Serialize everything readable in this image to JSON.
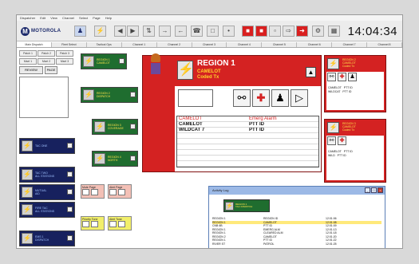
{
  "menubar": [
    "Dispatcher",
    "Edit",
    "View",
    "Channel",
    "Select",
    "Page",
    "Help"
  ],
  "toolbar": {
    "logo_text": "MOTOROLA",
    "clock": "14:04:34",
    "buttons": [
      "users-icon",
      "lightning-icon",
      "back-icon",
      "forward-icon",
      "split-icon",
      "arrow-icon",
      "arrow-icon",
      "monitor-icon",
      "phone-icon",
      "stop-icon",
      "stop-icon",
      "stop-icon",
      "chart-icon",
      "transfer-icon",
      "patch-icon",
      "settings-icon",
      "grid-icon"
    ]
  },
  "tabs": [
    "Main Dispatch",
    "Fleet Select",
    "Tactical Ops",
    "Channel 1",
    "Channel 2",
    "Channel 3",
    "Channel 4",
    "Channel 5",
    "Channel 6",
    "Channel 7",
    "Channel 8"
  ],
  "left_panel": {
    "segments": [
      "Patch 1",
      "Patch 2",
      "Patch 3"
    ],
    "segments2": [
      "Msel 1",
      "Msel 2",
      "Msel 3"
    ],
    "btn_review": "REVIEW",
    "btn_page": "PAGE"
  },
  "tiles_green": [
    {
      "line1": "REGION 1",
      "line2": "CAMELOT"
    },
    {
      "line1": "REGION 2",
      "line2": "DISPATCH"
    },
    {
      "line1": "REGION 3",
      "line2": "COVERAGE"
    },
    {
      "line1": "REGION 4",
      "line2": "NORTH"
    }
  ],
  "tiles_navy": [
    {
      "line1": "TAC ONE",
      "line2": ""
    },
    {
      "line1": "TAC TWO",
      "line2": "ALL STATIONS"
    },
    {
      "line1": "MUTUAL",
      "line2": "AID"
    },
    {
      "line1": "FIRE TAC",
      "line2": "ALL STATIONS"
    },
    {
      "line1": "EMS 1",
      "line2": "DISPATCH"
    }
  ],
  "minis": [
    {
      "label": "Mute Page",
      "color": "pink"
    },
    {
      "label": "Alert Page",
      "color": "pink"
    },
    {
      "label": "Priority Tone",
      "color": "yellow"
    },
    {
      "label": "Alert Tone",
      "color": "yellow"
    }
  ],
  "region": {
    "title": "REGION 1",
    "line1": "CAMELOT",
    "line2": "Coded Tx",
    "controls": [
      "lock-icon",
      "red-cross-icon",
      "people-icon",
      "radio-icon"
    ],
    "grid_header": [
      "CAMELOT",
      "Emerg Alarm"
    ],
    "grid_rows": [
      [
        "CAMELOT",
        "PTT ID"
      ],
      [
        "WILDCAT 7",
        "PTT ID"
      ]
    ]
  },
  "side_regions": [
    {
      "title": "REGION 2\nCAMELOT\nCoded Tx",
      "rows": [
        [
          "CAMELOT",
          "PTT ID"
        ],
        [
          "WILDCAT",
          "PTT ID"
        ]
      ]
    },
    {
      "title": "REGION 3\nCAMELOT\nCoded Tx",
      "rows": [
        [
          "CAMELOT",
          "PTT ID"
        ],
        [
          "WILD",
          "PTT ID"
        ]
      ]
    }
  ],
  "select_list": {
    "title": "Activity Log",
    "tile": "REGION 1\nTAC DISPATCH",
    "rows": [
      [
        "REGION 1",
        "REGION ID",
        "12:01:06"
      ],
      [
        "REGION 1",
        "CAMELOT",
        "12:01:08"
      ],
      [
        "CNB 6B",
        "PTT ID",
        "12:01:09"
      ],
      [
        "REGION 1",
        "EMERG ALM",
        "12:01:13"
      ],
      [
        "REGION 1",
        "CLEARED ALM",
        "12:01:18"
      ],
      [
        "REGION 2",
        "CAMELOT",
        "12:01:20"
      ],
      [
        "REGION 1",
        "PTT ID",
        "12:01:22"
      ],
      [
        "RIVER ST",
        "PATROL",
        "12:01:25"
      ]
    ]
  },
  "colors": {
    "region_red": "#d42222",
    "tile_green": "#1f6d2f",
    "tile_navy": "#17215e",
    "accent_yellow": "#ffd42a"
  }
}
